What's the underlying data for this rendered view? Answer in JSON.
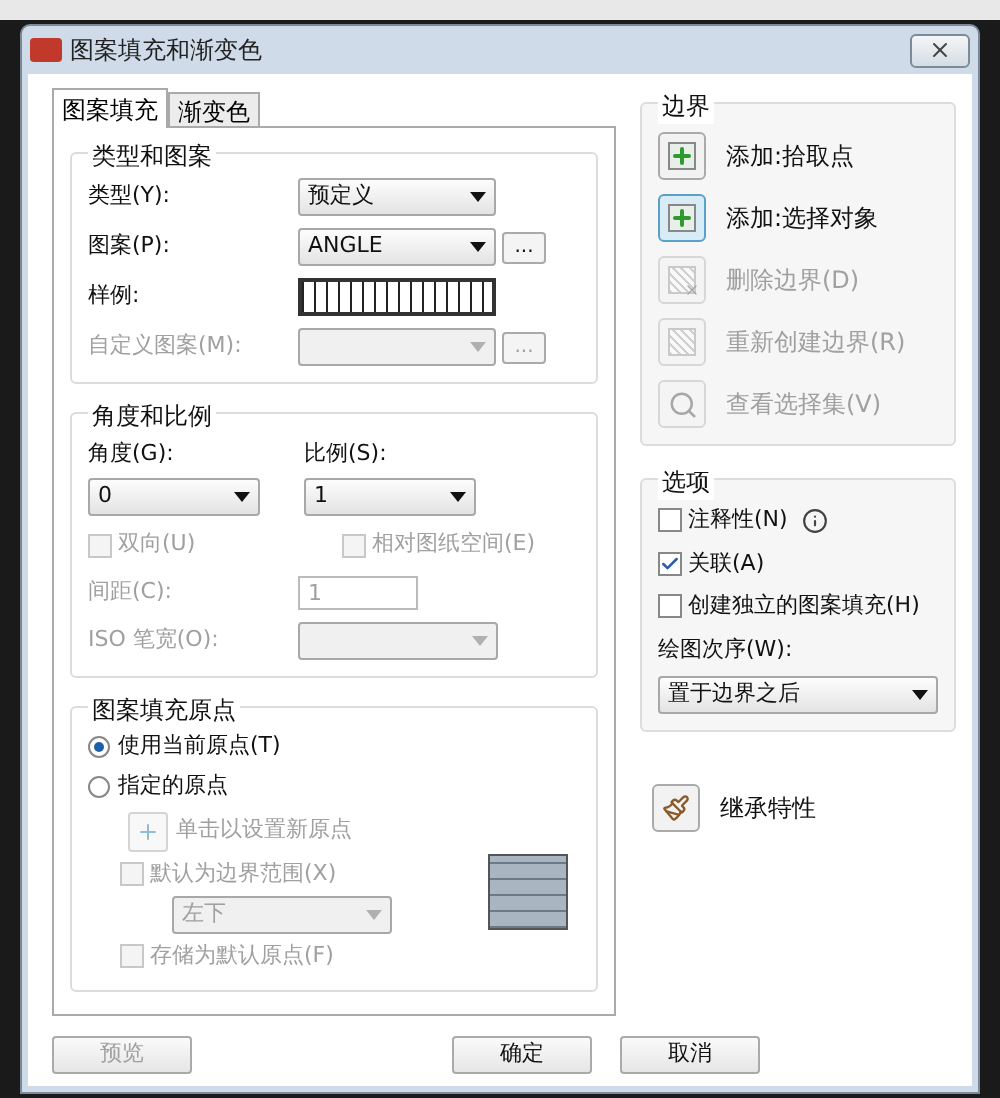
{
  "window": {
    "title": "图案填充和渐变色"
  },
  "tabs": [
    {
      "label": "图案填充",
      "selected": true
    },
    {
      "label": "渐变色",
      "selected": false
    }
  ],
  "type_and_pattern": {
    "title": "类型和图案",
    "fields": [
      {
        "label": "类型(Y):",
        "value": "预定义",
        "kind": "dropdown",
        "disabled": false
      },
      {
        "label": "图案(P):",
        "value": "ANGLE",
        "kind": "browse",
        "browse": "...",
        "disabled": false
      },
      {
        "label": "样例:",
        "kind": "swatch",
        "disabled": false
      },
      {
        "label": "自定义图案(M):",
        "kind": "browse",
        "browse": "...",
        "disabled": true
      }
    ]
  },
  "angle_scale": {
    "title": "角度和比例",
    "angle": {
      "label": "角度(G):",
      "value": "0"
    },
    "scale": {
      "label": "比例(S):",
      "value": "1"
    },
    "checks": [
      {
        "label": "双向(U)",
        "checked": false,
        "disabled": true
      },
      {
        "label": "相对图纸空间(E)",
        "checked": false,
        "disabled": true
      }
    ],
    "spacing": {
      "label": "间距(C):",
      "value": "1",
      "disabled": true
    },
    "iso": {
      "label": "ISO 笔宽(O):",
      "disabled": true
    }
  },
  "origin": {
    "title": "图案填充原点",
    "radios": [
      {
        "label": "使用当前原点(T)",
        "selected": true
      },
      {
        "label": "指定的原点",
        "selected": false
      }
    ],
    "set_origin": {
      "label": "单击以设置新原点",
      "disabled": true
    },
    "default_extent": {
      "label": "默认为边界范围(X)",
      "checked": false,
      "disabled": true
    },
    "position": {
      "value": "左下",
      "disabled": true
    },
    "store": {
      "label": "存储为默认原点(F)",
      "checked": false,
      "disabled": true
    }
  },
  "boundary": {
    "title": "边界",
    "buttons": [
      {
        "label": "添加:拾取点",
        "kind": "pick",
        "disabled": false
      },
      {
        "label": "添加:选择对象",
        "kind": "select",
        "disabled": false
      },
      {
        "label": "删除边界(D)",
        "kind": "remove",
        "disabled": true
      },
      {
        "label": "重新创建边界(R)",
        "kind": "recreate",
        "disabled": true
      },
      {
        "label": "查看选择集(V)",
        "kind": "view",
        "disabled": true
      }
    ]
  },
  "options": {
    "title": "选项",
    "checks": [
      {
        "label": "注释性(N)",
        "checked": false,
        "kind": "with_info"
      },
      {
        "label": "关联(A)",
        "checked": true,
        "kind": "plain"
      },
      {
        "label": "创建独立的图案填充(H)",
        "checked": false,
        "kind": "plain"
      }
    ],
    "draw_order": {
      "label": "绘图次序(W):",
      "value": "置于边界之后"
    }
  },
  "inherit": {
    "label": "继承特性"
  },
  "footer": [
    {
      "label": "预览",
      "disabled": true
    },
    {
      "label": "确定",
      "disabled": false
    },
    {
      "label": "取消",
      "disabled": false
    }
  ]
}
